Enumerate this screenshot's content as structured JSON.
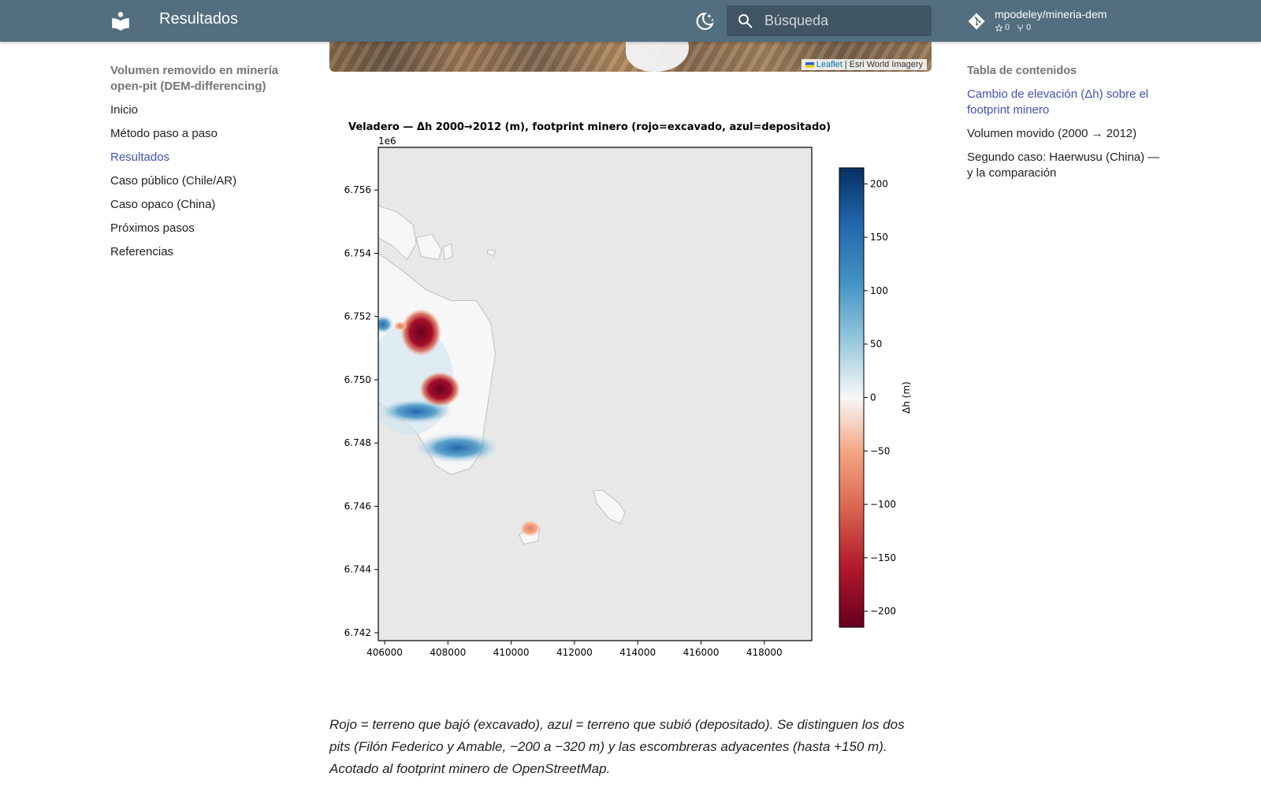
{
  "header": {
    "title": "Resultados",
    "search_placeholder": "Búsqueda",
    "repo": {
      "name": "mpodeley/mineria-dem",
      "stars": "0",
      "forks": "0"
    },
    "colors": {
      "bar": "#526e7f",
      "accent": "#4051b5"
    },
    "icons": [
      "book-icon",
      "theme-toggle-icon",
      "search-icon",
      "git-icon",
      "star-icon",
      "fork-icon"
    ]
  },
  "nav": {
    "title": "Volumen removido en minería open-pit (DEM-differencing)",
    "items": [
      {
        "label": "Inicio",
        "active": false
      },
      {
        "label": "Método paso a paso",
        "active": false
      },
      {
        "label": "Resultados",
        "active": true
      },
      {
        "label": "Caso público (Chile/AR)",
        "active": false
      },
      {
        "label": "Caso opaco (China)",
        "active": false
      },
      {
        "label": "Próximos pasos",
        "active": false
      },
      {
        "label": "Referencias",
        "active": false
      }
    ]
  },
  "toc": {
    "title": "Tabla de contenidos",
    "items": [
      {
        "label": "Cambio de elevación (Δh) sobre el footprint minero",
        "active": true
      },
      {
        "label": "Volumen movido (2000 → 2012)",
        "active": false
      },
      {
        "label": "Segundo caso: Haerwusu (China) — y la comparación",
        "active": false
      }
    ]
  },
  "map": {
    "attribution_leaflet": "Leaflet",
    "attribution_rest": "| Esri World Imagery"
  },
  "chart_data": {
    "type": "heatmap",
    "title": "Veladero — Δh 2000→2012 (m), footprint minero (rojo=excavado, azul=depositado)",
    "xlabel": "",
    "ylabel": "",
    "y_offset_label": "1e6",
    "xlim": [
      405800,
      419500
    ],
    "ylim": [
      6.74175,
      6.75735
    ],
    "xticks": [
      406000,
      408000,
      410000,
      412000,
      414000,
      416000,
      418000
    ],
    "xtick_labels": [
      "406000",
      "408000",
      "410000",
      "412000",
      "414000",
      "416000",
      "418000"
    ],
    "yticks": [
      6.742,
      6.744,
      6.746,
      6.748,
      6.75,
      6.752,
      6.754,
      6.756
    ],
    "ytick_labels": [
      "6.742",
      "6.744",
      "6.746",
      "6.748",
      "6.750",
      "6.752",
      "6.754",
      "6.756"
    ],
    "colorbar": {
      "label": "Δh (m)",
      "colormap": "RdBu",
      "range": [
        -215,
        215
      ],
      "ticks": [
        200,
        150,
        100,
        50,
        0,
        -50,
        -100,
        -150,
        -200
      ],
      "tick_labels": [
        "200",
        "150",
        "100",
        "50",
        "0",
        "−50",
        "−100",
        "−150",
        "−200"
      ]
    },
    "background_color": "#e8e8e8",
    "features": [
      {
        "name": "pit-filon-federico",
        "x": 407150,
        "y": 6.7515,
        "dh": -210
      },
      {
        "name": "pit-amable",
        "x": 407750,
        "y": 6.7497,
        "dh": -210
      },
      {
        "name": "escombrera-norte",
        "x": 408300,
        "y": 6.74785,
        "dh": 110
      },
      {
        "name": "escombrera-oeste",
        "x": 407000,
        "y": 6.749,
        "dh": 130
      },
      {
        "name": "deposito-pequeno-sur",
        "x": 410600,
        "y": 6.7453,
        "dh": -70
      }
    ]
  },
  "caption": "Rojo = terreno que bajó (excavado), azul = terreno que subió (depositado). Se distinguen los dos pits (Filón Federico y Amable, −200 a −320 m) y las escombreras adyacentes (hasta +150 m). Acotado al footprint minero de OpenStreetMap."
}
